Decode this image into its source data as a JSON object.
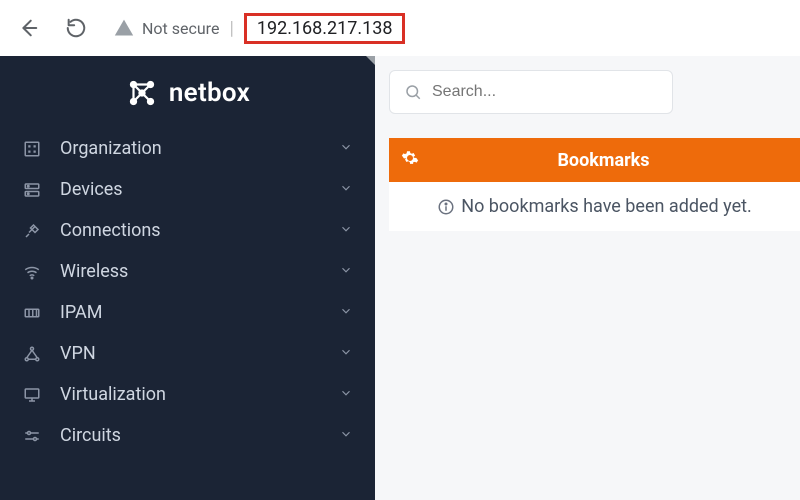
{
  "browser": {
    "not_secure_label": "Not secure",
    "url": "192.168.217.138"
  },
  "brand": {
    "name": "netbox"
  },
  "sidebar": {
    "items": [
      {
        "label": "Organization",
        "icon": "building-icon"
      },
      {
        "label": "Devices",
        "icon": "server-icon"
      },
      {
        "label": "Connections",
        "icon": "plug-icon"
      },
      {
        "label": "Wireless",
        "icon": "wifi-icon"
      },
      {
        "label": "IPAM",
        "icon": "counter-icon"
      },
      {
        "label": "VPN",
        "icon": "graph-icon"
      },
      {
        "label": "Virtualization",
        "icon": "monitor-icon"
      },
      {
        "label": "Circuits",
        "icon": "circuit-icon"
      }
    ]
  },
  "search": {
    "placeholder": "Search..."
  },
  "panel": {
    "title": "Bookmarks",
    "empty_text": "No bookmarks have been added yet."
  }
}
